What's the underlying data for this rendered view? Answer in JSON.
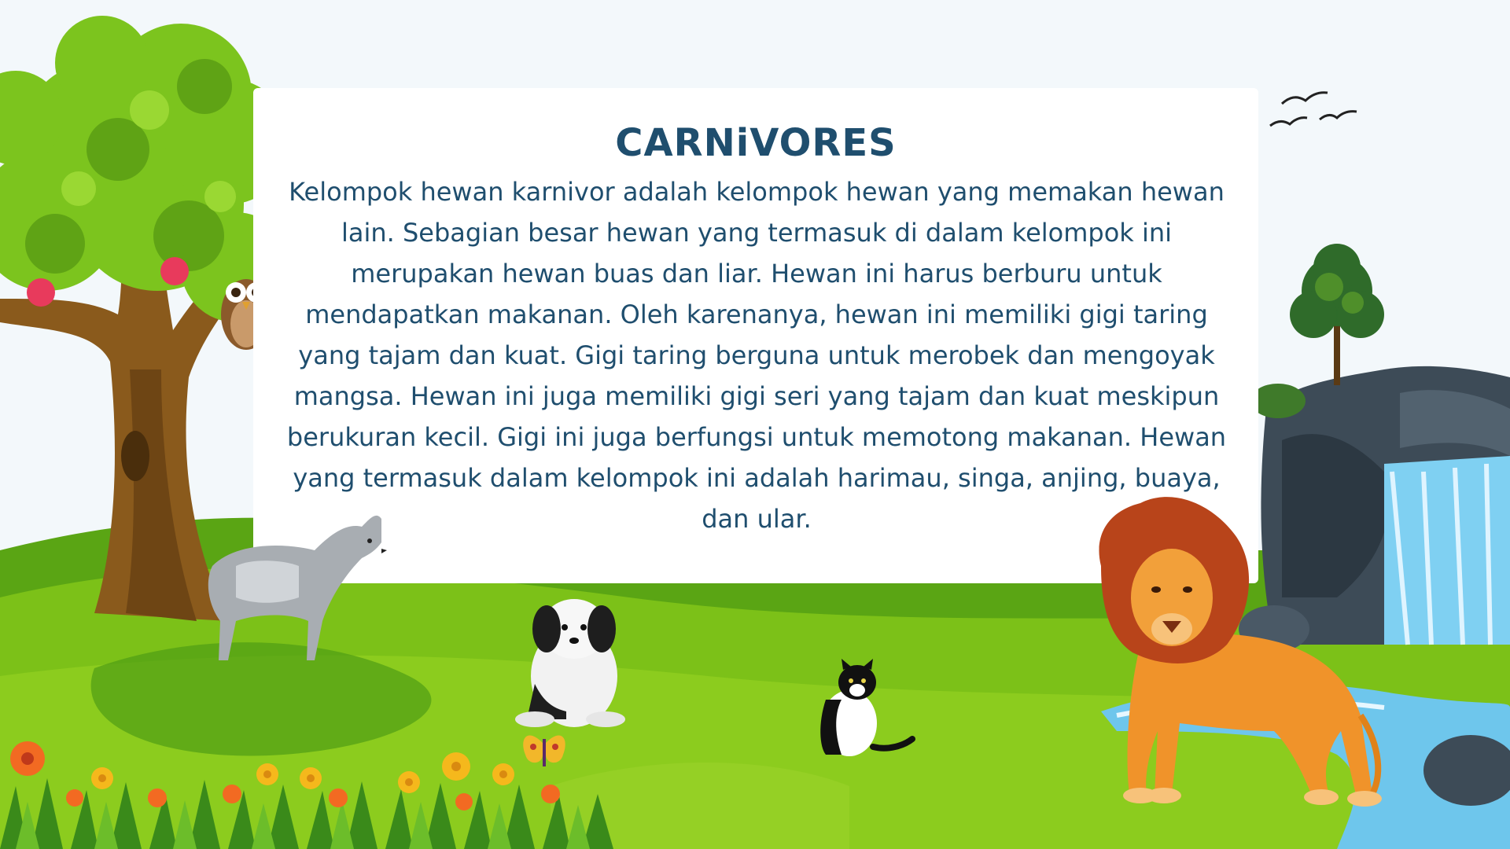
{
  "slide": {
    "title": "CARNiVORES",
    "body": "Kelompok hewan karnivor adalah kelompok hewan yang memakan hewan lain. Sebagian besar hewan yang termasuk di dalam kelompok ini merupakan hewan buas dan liar. Hewan ini harus berburu untuk mendapatkan makanan. Oleh karenanya, hewan ini memiliki gigi taring yang tajam dan kuat. Gigi taring berguna untuk merobek dan mengoyak mangsa. Hewan ini juga memiliki gigi seri yang tajam dan kuat meskipun berukuran kecil. Gigi ini juga berfungsi untuk memotong makanan. Hewan yang termasuk dalam kelompok ini adalah harimau, singa, anjing, buaya, dan ular."
  },
  "colors": {
    "sky": "#f3f8fb",
    "grass_dark": "#4f9a12",
    "grass_light": "#8cc81e",
    "text": "#1f4e6e",
    "tree_trunk": "#8a5a1c",
    "leaves": "#7cc41e",
    "rock": "#3d4b57",
    "water": "#6ec6ec"
  },
  "illustrations": [
    "apple-tree",
    "owl",
    "wolf",
    "dog",
    "cat",
    "butterfly",
    "flowers",
    "lion",
    "waterfall",
    "rocks",
    "small-tree",
    "birds"
  ]
}
